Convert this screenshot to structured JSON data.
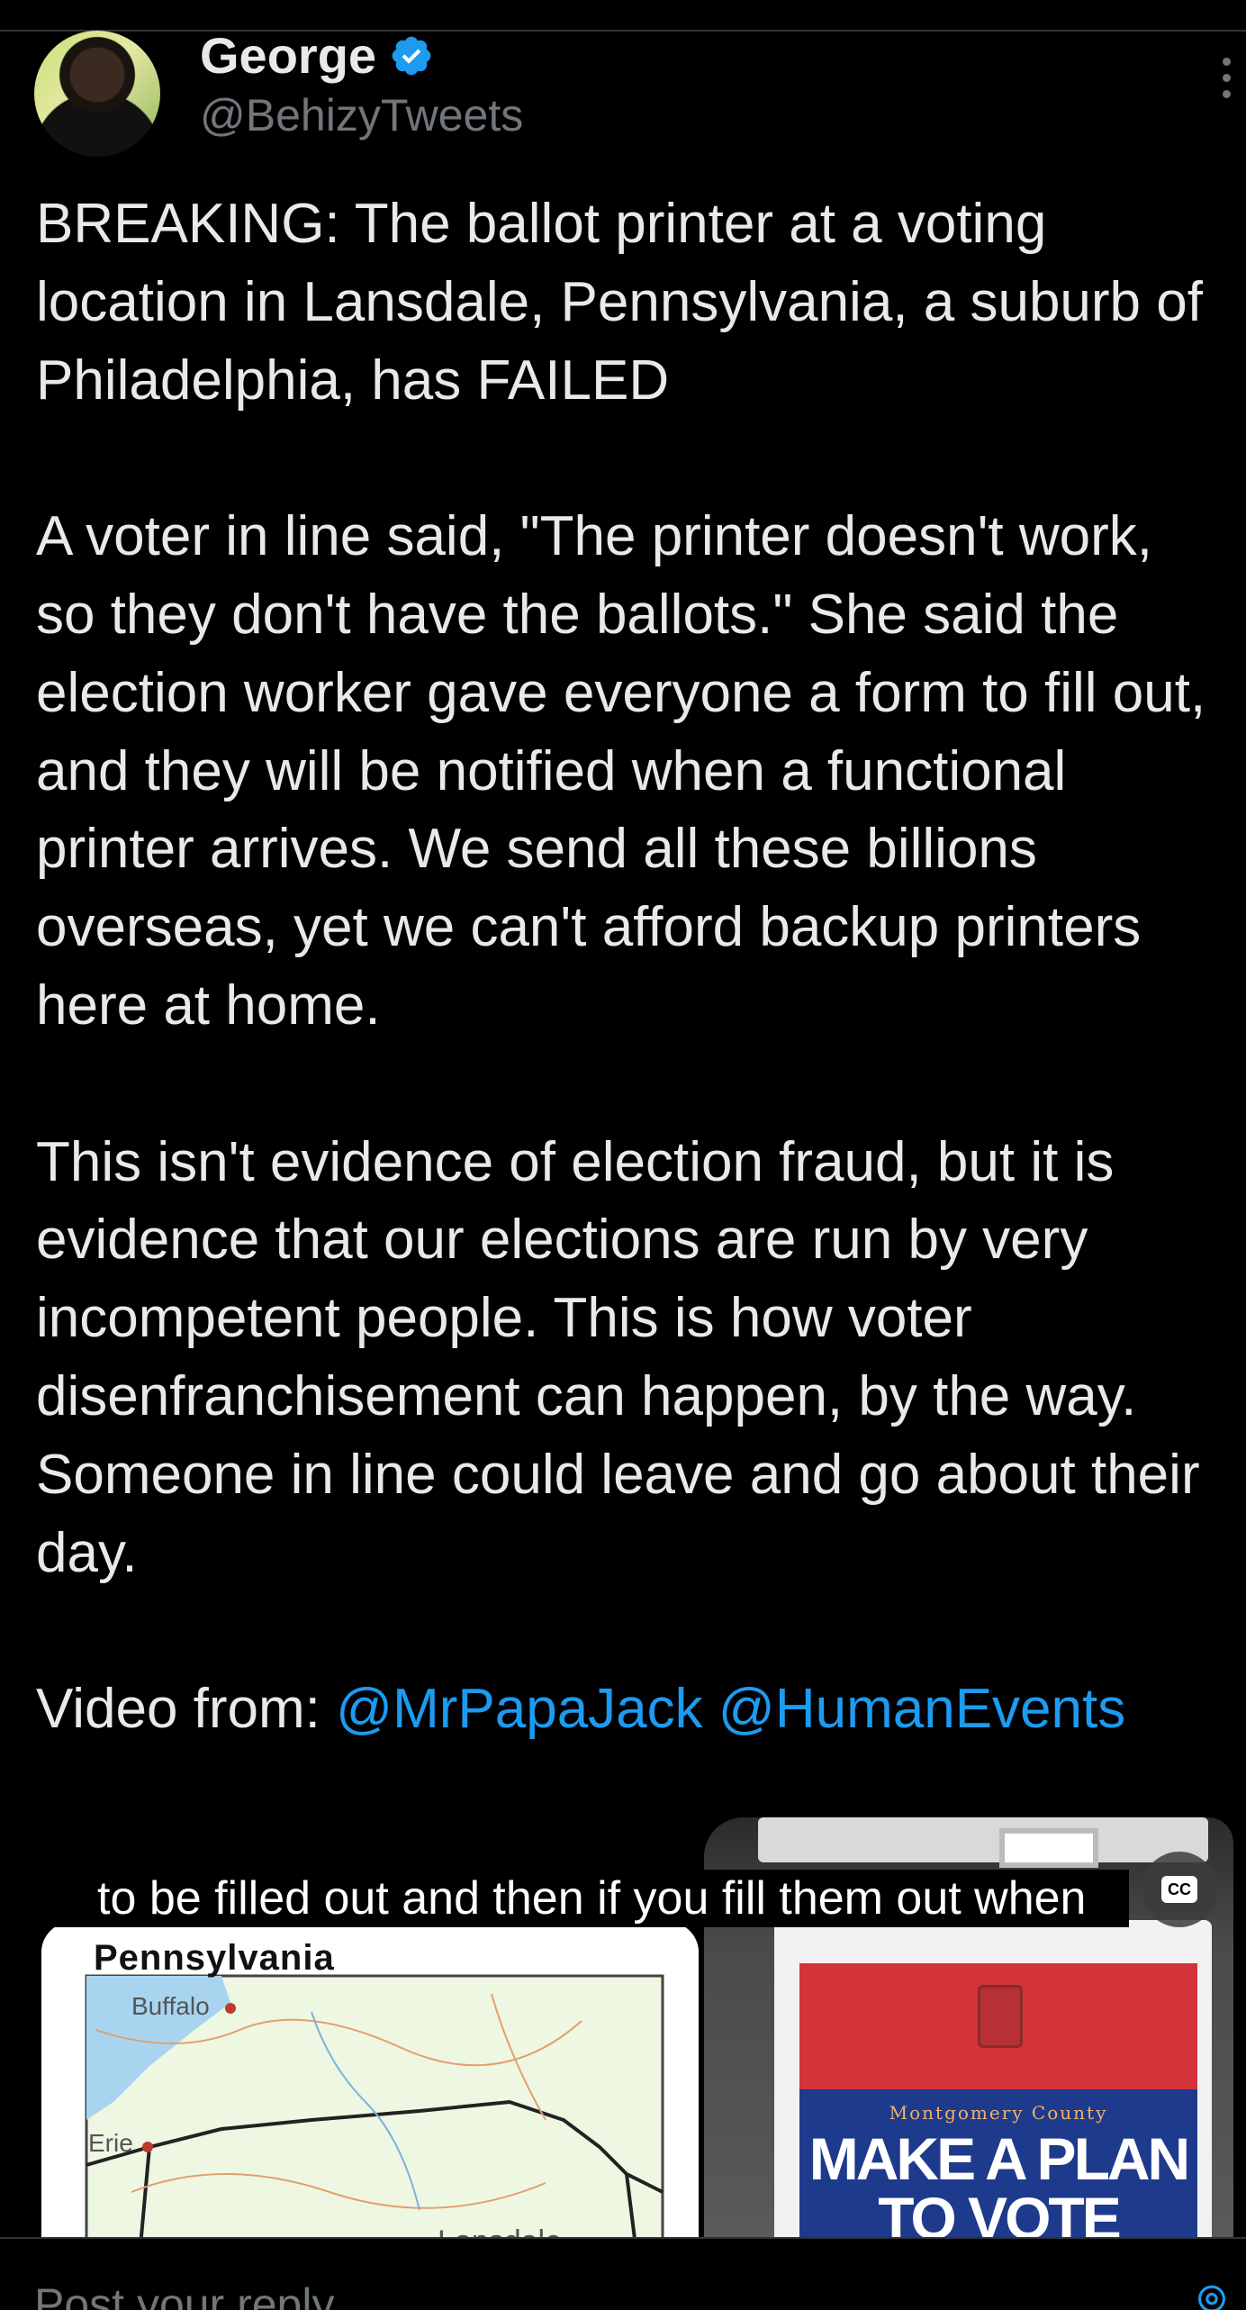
{
  "author": {
    "display_name": "George",
    "handle": "@BehizyTweets",
    "verified": true
  },
  "tweet": {
    "paragraph_1": "BREAKING: The ballot printer at a voting location in Lansdale, Pennsylvania, a suburb of Philadelphia, has FAILED",
    "paragraph_2": "A voter in line said, \"The printer doesn't work, so they don't have the ballots.\" She said the election worker gave everyone a form to fill out, and they will be notified when a functional printer arrives. We send all these billions overseas, yet we can't afford backup printers here at home.",
    "paragraph_3": "This isn't evidence of election fraud, but it is evidence that our elections are run by very incompetent people. This is how voter disenfranchisement can happen, by the way. Someone in line could leave and go about their day.",
    "video_credit_prefix": "Video from: ",
    "mention_1": "@MrPapaJack",
    "mention_2": "@HumanEvents"
  },
  "media": {
    "caption": "to be filled out and then if you fill them out when",
    "cc_label": "CC",
    "map": {
      "title": "Pennsylvania",
      "label_buffalo": "Buffalo",
      "label_erie": "Erie",
      "label_lansdale": "Lansdale"
    },
    "sign": {
      "county": "Montgomery County",
      "line_1": "MAKE A PLAN",
      "line_2": "TO VOTE"
    }
  },
  "footer": {
    "reply_placeholder": "Post your reply"
  },
  "colors": {
    "background": "#000000",
    "text": "#e7e9ea",
    "secondary": "#71767b",
    "accent": "#1d9bf0"
  },
  "icons": [
    "verified-badge-icon",
    "more-options-icon",
    "closed-captions-icon",
    "settings-icon"
  ]
}
